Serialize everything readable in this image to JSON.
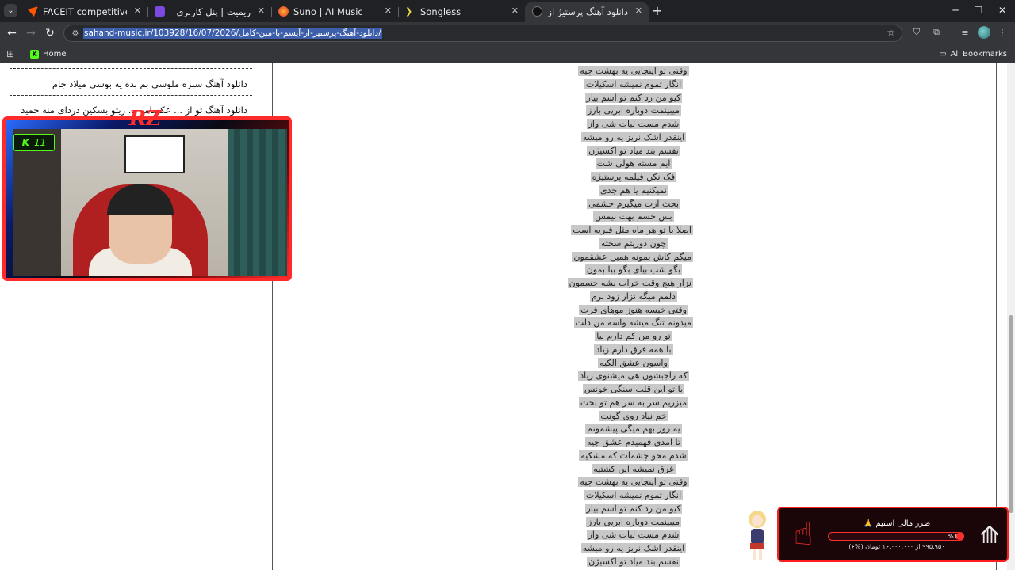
{
  "tabs": [
    {
      "title": "FACEIT competitive match - FAC",
      "favicon_color": "#ff5500",
      "rtl": false
    },
    {
      "title": "ریمیت | پنل کاربری",
      "favicon_color": "#7b4ae2",
      "rtl": true
    },
    {
      "title": "Suno | AI Music",
      "favicon_color": "#f36b21",
      "rtl": false
    },
    {
      "title": "Songless",
      "favicon_color": "#e8d84a",
      "rtl": false
    },
    {
      "title": "دانلود آهنگ پرستیژ از آیسم با متن",
      "favicon_color": "#333333",
      "rtl": true,
      "active": true
    }
  ],
  "toolbar": {
    "url": "sahand-music.ir/103928/16/07/2026/دانلود-آهنگ-پرستیژ-از-آیسم-با-متن-کامل/"
  },
  "bookmarks": {
    "home_label": "Home",
    "all_label": "All Bookmarks"
  },
  "sidebar": {
    "links": [
      "دانلود آهنگ سبزه ملوسی بم بده یه بوسی میلاد جام",
      "دانلود آهنگ تو از ... عکسامو ... ریتو بسکین دردای منه حمید"
    ]
  },
  "lyrics": [
    "وقتی تو اینجایی یه بهشت چیه",
    "انگار تموم نمیشه اسکیلات",
    "کیو من رد کنم تو اسم بیار",
    "میبینمت دوباره ابریی بارز",
    "شدم مست لبات شی واز",
    "اینقدر اشک نریز یه رو میشه",
    "نفسم بند میاد تو اکسیژن",
    "ایم مسته هولی شت",
    "فک نکن فیلمه پرستیژه",
    "نمیکنیم یا هم جدی",
    "بحث ازت میگیرم چشمی",
    "بس حسم بهت بیمس",
    "اصلا با تو هر ماه مثل فبریه است",
    "چون دوریتم سخته",
    "میگم کاش بمونه همین عشقمون",
    "بگو شب بیای بگو بیا بمون",
    "نزار هیچ وقت خراب بشه حسمون",
    "دلمم میگه نزار زود برم",
    "وقتی خیسه هنوز موهای فرت",
    "میدونم تنگ میشه واسه من دلت",
    "تو رو من کم دارم بیا",
    "با همه فرق دارم زیاد",
    "واسون عشق الکیه",
    "که راجبشون هی میشنوی زیاد",
    "با تو این قلب سنگی خونس",
    "میزریم سر به سر هم تو بحث",
    "خم نیاد روی گونت",
    "یه روز بهم میگی پیشمونم",
    "تا امدی فهمیدم عشق چیه",
    "شدم محو چشمات که مشکیه",
    "غرق نمیشه این کشتیه",
    "وقتی تو اینجایی یه بهشت چیه",
    "انگار تموم نمیشه اسکیلات",
    "کیو من رد کنم تو اسم بیار",
    "میبینمت دوباره ابریی بارز",
    "شدم مست لبات شی واز",
    "اینقدر اشک نریز یه رو میشه",
    "نفسم بند میاد تو اکسیژن"
  ],
  "webcam": {
    "logo": "RZ",
    "badge_letter": "K",
    "badge_number": "11"
  },
  "goal": {
    "title": "ضرر مالی استیم 🙏",
    "percent_label": "%۶",
    "percent_value": 6,
    "amount": "۹۹۵,۹۵۰ از ۱۶,۰۰۰,۰۰۰ تومان (%۶)",
    "accent": "#ff3030"
  }
}
